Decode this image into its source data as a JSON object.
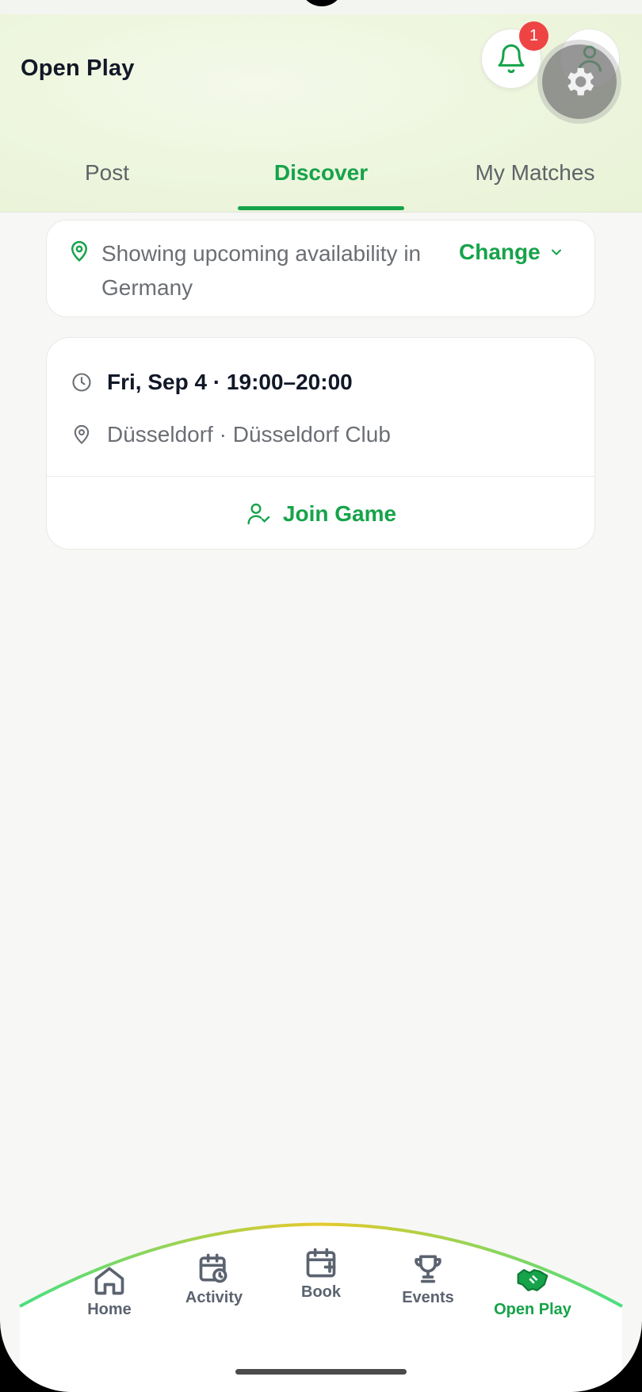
{
  "header": {
    "title": "Open Play",
    "notifications_count": "1"
  },
  "tabs": [
    {
      "label": "Post",
      "active": false
    },
    {
      "label": "Discover",
      "active": true
    },
    {
      "label": "My Matches",
      "active": false
    }
  ],
  "location": {
    "text": "Showing upcoming availability in Germany",
    "change_label": "Change"
  },
  "game": {
    "time": "Fri, Sep 4 · 19:00–20:00",
    "place": "Düsseldorf · Düsseldorf Club",
    "join_label": "Join Game"
  },
  "bottom_nav": [
    {
      "label": "Home",
      "icon": "home-icon",
      "active": false
    },
    {
      "label": "Activity",
      "icon": "calendar-clock-icon",
      "active": false
    },
    {
      "label": "Book",
      "icon": "calendar-plus-icon",
      "active": false
    },
    {
      "label": "Events",
      "icon": "trophy-icon",
      "active": false
    },
    {
      "label": "Open Play",
      "icon": "handshake-icon",
      "active": true
    }
  ],
  "colors": {
    "accent": "#16a34a",
    "badge": "#ef4444",
    "text_dark": "#111827",
    "text_muted": "#6b6f74"
  }
}
